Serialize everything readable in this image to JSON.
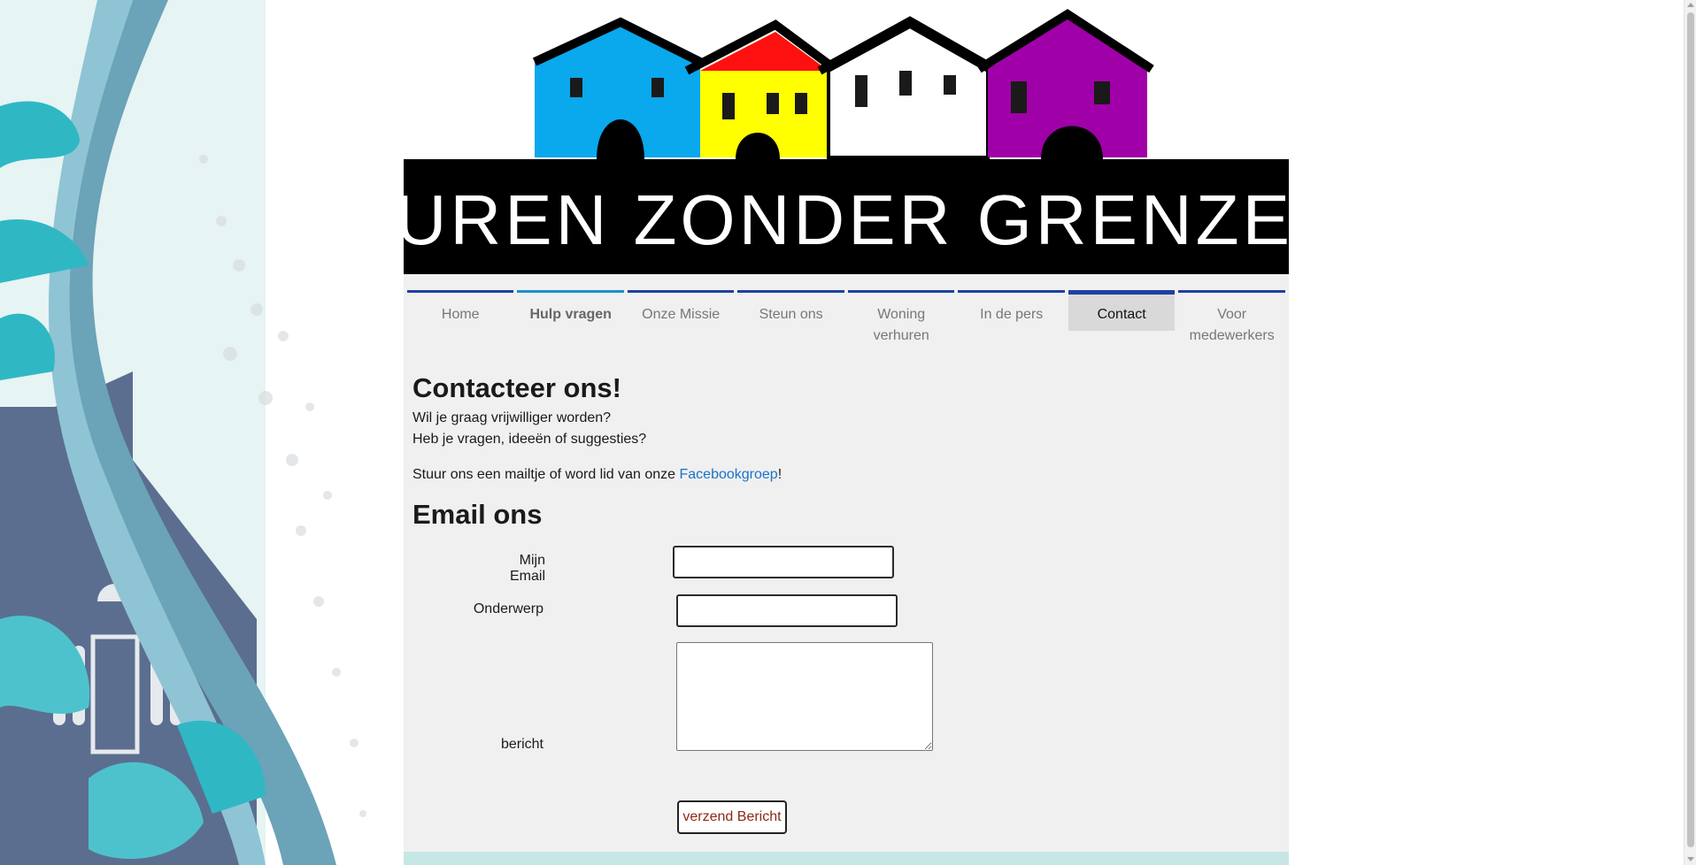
{
  "logo": {
    "text": "BUREN ZONDER GRENZEN"
  },
  "nav": {
    "items": [
      {
        "label": "Home"
      },
      {
        "label": "Hulp vragen"
      },
      {
        "label": "Onze Missie"
      },
      {
        "label": "Steun ons"
      },
      {
        "label": "Woning verhuren"
      },
      {
        "label": "In de pers"
      },
      {
        "label": "Contact"
      },
      {
        "label": "Voor medewerkers"
      }
    ],
    "active": "Contact"
  },
  "contact": {
    "title": "Contacteer ons!",
    "line1": "Wil je graag vrijwilliger worden?",
    "line2": "Heb je vragen, ideeën of suggesties?",
    "mail_text": "Stuur ons een mailtje of word lid van onze ",
    "fb_link": "Facebookgroep",
    "mail_suffix": "!"
  },
  "form": {
    "title": "Email ons",
    "email_label": "Mijn Email",
    "email_value": "",
    "subject_label": "Onderwerp",
    "subject_value": "",
    "message_label": "bericht",
    "message_value": "",
    "submit_label": "verzend Bericht"
  },
  "colors": {
    "nav_border": "#1f3fa3",
    "nav_active_bg": "#d9d9d9",
    "link": "#1a73c8",
    "submit_text": "#8b2a12",
    "footer": "#c6e7e5",
    "house_blue": "#0aa8ec",
    "house_yellow": "#ffff00",
    "house_red_roof": "#ff1010",
    "house_white": "#ffffff",
    "house_purple": "#a000a8"
  }
}
